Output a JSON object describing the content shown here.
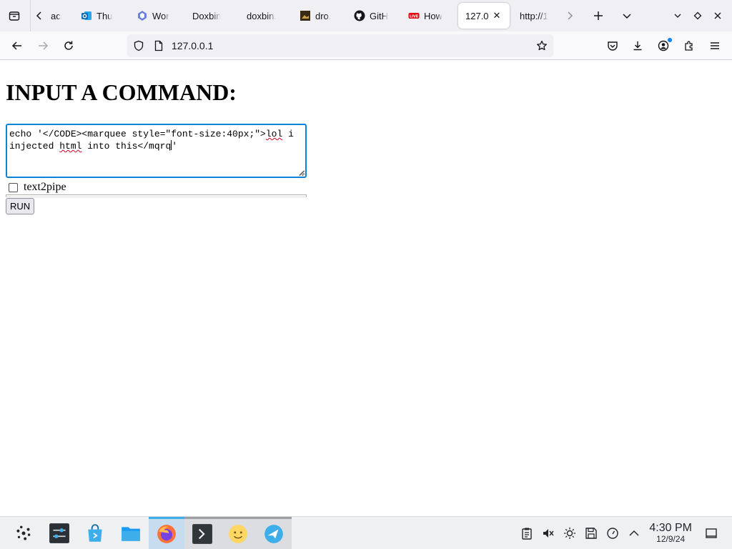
{
  "browser": {
    "tabs": [
      {
        "title": "ac",
        "icon": "generic-page-icon"
      },
      {
        "title": "Thu",
        "icon": "outlook-icon",
        "color": "#0f6cbd"
      },
      {
        "title": "Wor",
        "icon": "copilot-icon"
      },
      {
        "title": "Doxbin",
        "icon": "none"
      },
      {
        "title": "doxbin.",
        "icon": "none"
      },
      {
        "title": "dro.",
        "icon": "image-thumb-icon"
      },
      {
        "title": "GitH",
        "icon": "github-icon"
      },
      {
        "title": "How",
        "icon": "youtube-live-icon"
      },
      {
        "title": "127.0",
        "icon": "none",
        "active": true
      },
      {
        "title": "http://1",
        "icon": "none"
      }
    ],
    "url": "127.0.0.1"
  },
  "page": {
    "heading": "INPUT A COMMAND:",
    "command_parts": [
      "echo '</CODE><marquee style=\"font-size:40px;\">",
      "lol",
      " i\ninjected ",
      "html",
      " into this</mqrq",
      "'"
    ],
    "checkbox_label": "text2pipe",
    "checkbox_checked": false,
    "run_label": "RUN"
  },
  "taskbar": {
    "clock_time": "4:30 PM",
    "clock_date": "12/9/24",
    "accent": "#3daee9"
  }
}
